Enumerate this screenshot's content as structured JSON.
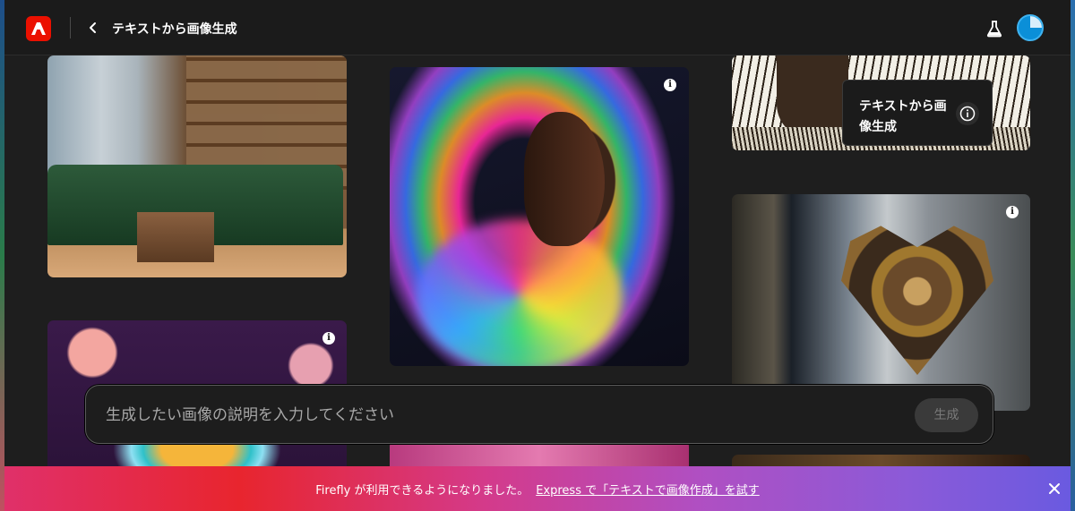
{
  "header": {
    "title": "テキストから画像生成"
  },
  "gallery": {
    "tooltip": {
      "text": "テキストから画像生成"
    },
    "info_glyph": "i"
  },
  "prompt": {
    "placeholder": "生成したい画像の説明を入力してください",
    "value": "",
    "generate_label": "生成"
  },
  "banner": {
    "message": "Firefly が利用できるようになりました。",
    "link_text": "Express で「テキストで画像作成」を試す"
  },
  "colors": {
    "adobe_red": "#eb1000",
    "background": "#1e1e1e",
    "avatar_blue": "#0b8fd8"
  },
  "icons": {
    "logo": "adobe-logo-icon",
    "back": "chevron-left-icon",
    "labs": "flask-icon",
    "info": "info-icon",
    "close": "close-icon"
  }
}
